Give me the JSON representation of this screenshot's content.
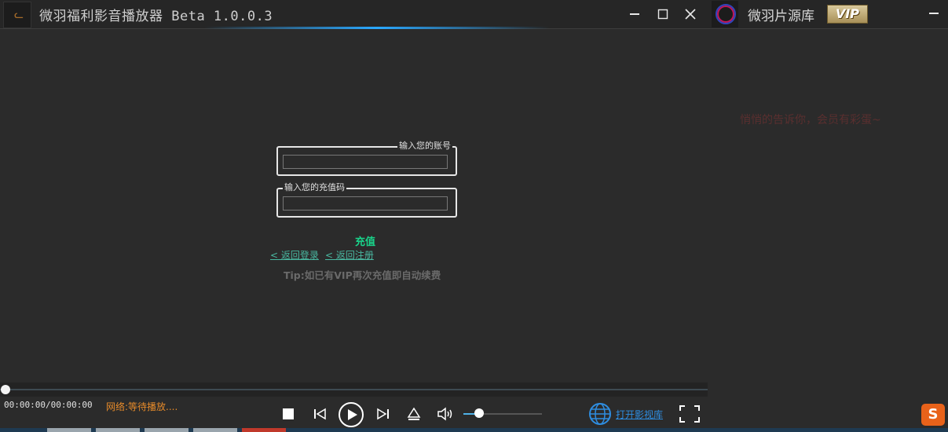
{
  "app": {
    "title": "微羽福利影音播放器  Beta 1.0.0.3"
  },
  "side_panel": {
    "title": "微羽片源库",
    "vip_badge": "VIP",
    "note": "悄悄的告诉你，会员有彩蛋~"
  },
  "recharge_form": {
    "account_legend": "输入您的账号",
    "account_value": "",
    "code_legend": "输入您的充值码",
    "code_value": "",
    "submit_label": "充值",
    "back_login": "< 返回登录",
    "back_register": "< 返回注册",
    "tip": "Tip:如已有VIP再次充值即自动续费"
  },
  "player": {
    "time": "00:00:00/00:00:00",
    "network_status": "网络:等待播放....",
    "progress": 0,
    "volume": 0.2,
    "open_library": "打开影视库"
  },
  "colors": {
    "background": "#2b2b2b",
    "accent_green": "#19d38a",
    "link_teal": "#49b7a0",
    "status_orange": "#e58a2a",
    "link_blue": "#2e8de0"
  },
  "icons": [
    "app-logo-icon",
    "minimize-icon",
    "maximize-icon",
    "close-icon",
    "side-logo-icon",
    "stop-icon",
    "prev-icon",
    "play-icon",
    "next-icon",
    "eject-icon",
    "volume-icon",
    "globe-icon",
    "fullscreen-icon",
    "sogou-icon"
  ]
}
